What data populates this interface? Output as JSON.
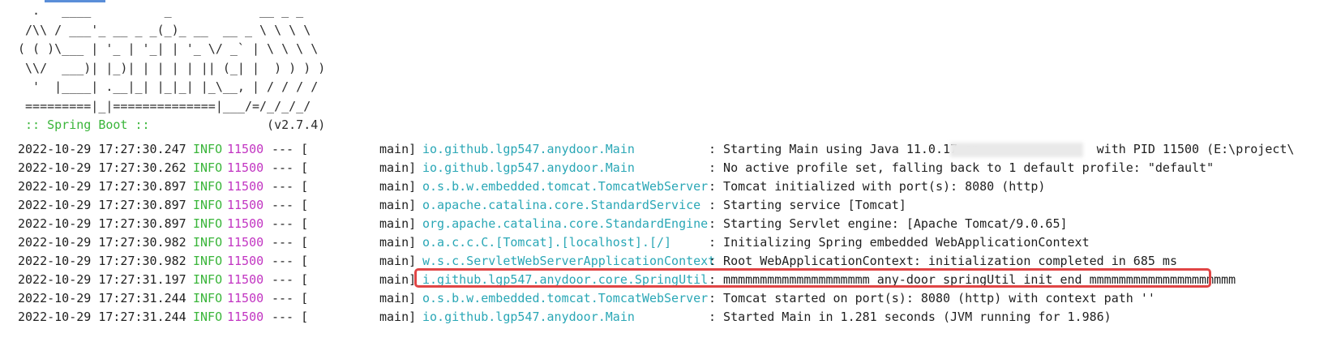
{
  "banner": {
    "lines": [
      "  .   ____          _            __ _ _",
      " /\\\\ / ___'_ __ _ _(_)_ __  __ _ \\ \\ \\ \\",
      "( ( )\\___ | '_ | '_| | '_ \\/ _` | \\ \\ \\ \\",
      " \\\\/  ___)| |_)| | | | | || (_| |  ) ) ) )",
      "  '  |____| .__|_| |_|_| |_\\__, | / / / /",
      " =========|_|==============|___/=/_/_/_/"
    ],
    "boot_label": " :: Spring Boot ::",
    "version": "                (v2.7.4)"
  },
  "log": {
    "rows": [
      {
        "timestamp": "2022-10-29 17:27:30.247",
        "level": "INFO",
        "pid": "11500",
        "dashes": "--- [",
        "thread": "main]",
        "logger": "io.github.lgp547.anydoor.Main",
        "message": ": Starting Main using Java 11.0.17 on                with PID 11500 (E:\\project\\"
      },
      {
        "timestamp": "2022-10-29 17:27:30.262",
        "level": "INFO",
        "pid": "11500",
        "dashes": "--- [",
        "thread": "main]",
        "logger": "io.github.lgp547.anydoor.Main",
        "message": ": No active profile set, falling back to 1 default profile: \"default\""
      },
      {
        "timestamp": "2022-10-29 17:27:30.897",
        "level": "INFO",
        "pid": "11500",
        "dashes": "--- [",
        "thread": "main]",
        "logger": "o.s.b.w.embedded.tomcat.TomcatWebServer",
        "message": ": Tomcat initialized with port(s): 8080 (http)"
      },
      {
        "timestamp": "2022-10-29 17:27:30.897",
        "level": "INFO",
        "pid": "11500",
        "dashes": "--- [",
        "thread": "main]",
        "logger": "o.apache.catalina.core.StandardService",
        "message": ": Starting service [Tomcat]"
      },
      {
        "timestamp": "2022-10-29 17:27:30.897",
        "level": "INFO",
        "pid": "11500",
        "dashes": "--- [",
        "thread": "main]",
        "logger": "org.apache.catalina.core.StandardEngine",
        "message": ": Starting Servlet engine: [Apache Tomcat/9.0.65]"
      },
      {
        "timestamp": "2022-10-29 17:27:30.982",
        "level": "INFO",
        "pid": "11500",
        "dashes": "--- [",
        "thread": "main]",
        "logger": "o.a.c.c.C.[Tomcat].[localhost].[/]",
        "message": ": Initializing Spring embedded WebApplicationContext"
      },
      {
        "timestamp": "2022-10-29 17:27:30.982",
        "level": "INFO",
        "pid": "11500",
        "dashes": "--- [",
        "thread": "main]",
        "logger": "w.s.c.ServletWebServerApplicationContext",
        "message": ": Root WebApplicationContext: initialization completed in 685 ms"
      },
      {
        "timestamp": "2022-10-29 17:27:31.197",
        "level": "INFO",
        "pid": "11500",
        "dashes": "--- [",
        "thread": "main]",
        "logger": "i.github.lgp547.anydoor.core.SpringUtil",
        "message": ": mmmmmmmmmmmmmmmmmmmm any-door springUtil init end mmmmmmmmmmmmmmmmmmmm"
      },
      {
        "timestamp": "2022-10-29 17:27:31.244",
        "level": "INFO",
        "pid": "11500",
        "dashes": "--- [",
        "thread": "main]",
        "logger": "o.s.b.w.embedded.tomcat.TomcatWebServer",
        "message": ": Tomcat started on port(s): 8080 (http) with context path ''"
      },
      {
        "timestamp": "2022-10-29 17:27:31.244",
        "level": "INFO",
        "pid": "11500",
        "dashes": "--- [",
        "thread": "main]",
        "logger": "io.github.lgp547.anydoor.Main",
        "message": ": Started Main in 1.281 seconds (JVM running for 1.986)"
      }
    ]
  },
  "colors": {
    "level_info": "#3ab53a",
    "pid": "#c235c2",
    "logger": "#2aa7b6",
    "highlight_border": "#e04545"
  }
}
